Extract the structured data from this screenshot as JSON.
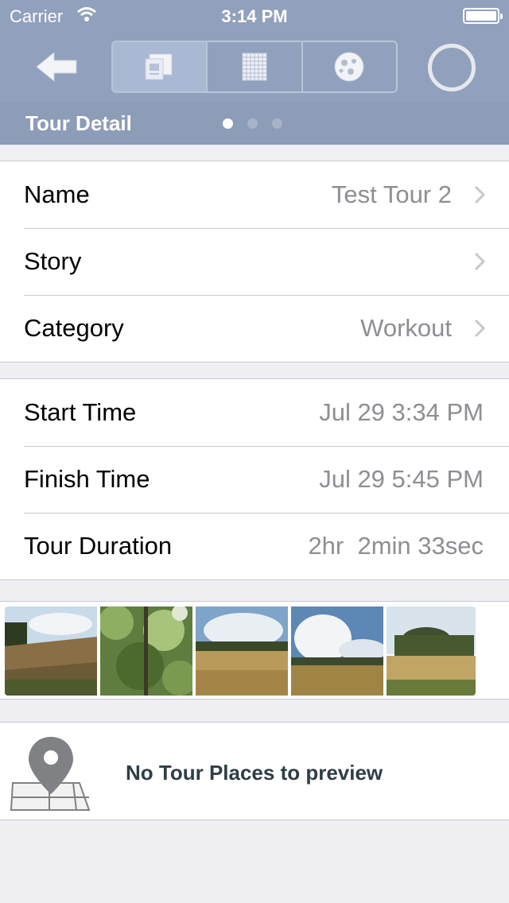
{
  "status_bar": {
    "carrier": "Carrier",
    "time": "3:14 PM"
  },
  "nav": {
    "back_icon": "back-arrow-icon",
    "segments": [
      {
        "icon": "tour-detail-icon",
        "selected": true
      },
      {
        "icon": "grid-icon",
        "selected": false
      },
      {
        "icon": "globe-icon",
        "selected": false
      }
    ],
    "spinner_icon": "circle-icon"
  },
  "subheader": {
    "title": "Tour Detail",
    "page_count": 3,
    "current_page": 1
  },
  "details": [
    {
      "label": "Name",
      "value": "Test Tour 2",
      "disclosure": true
    },
    {
      "label": "Story",
      "value": "",
      "disclosure": true
    },
    {
      "label": "Category",
      "value": "Workout",
      "disclosure": true
    }
  ],
  "times": [
    {
      "label": "Start Time",
      "value": "Jul 29 3:34 PM"
    },
    {
      "label": "Finish Time",
      "value": "Jul 29 5:45 PM"
    },
    {
      "label": "Tour Duration",
      "value": "2hr  2min 33sec"
    }
  ],
  "photos": [
    {
      "name": "photo-field-1"
    },
    {
      "name": "photo-forest"
    },
    {
      "name": "photo-field-2"
    },
    {
      "name": "photo-field-3"
    },
    {
      "name": "photo-field-4"
    }
  ],
  "places": {
    "icon": "map-pin-icon",
    "message": "No Tour Places to preview"
  },
  "colors": {
    "nav_bar": "#91a0bc",
    "sub_bar": "#8d9cb7",
    "background": "#efeff4",
    "secondary_text": "#8e8e93"
  }
}
